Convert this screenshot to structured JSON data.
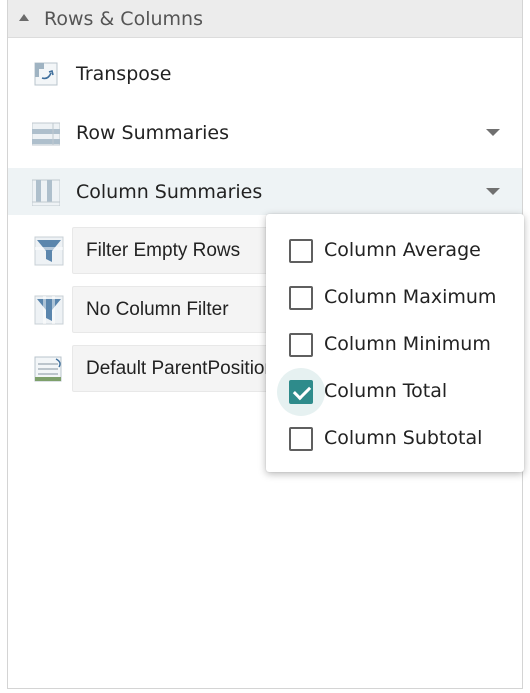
{
  "panel": {
    "title": "Rows & Columns",
    "items": [
      {
        "label": "Transpose",
        "icon": "transpose-icon"
      },
      {
        "label": "Row Summaries",
        "icon": "row-summaries-icon"
      },
      {
        "label": "Column Summaries",
        "icon": "column-summaries-icon"
      }
    ],
    "buttons": [
      {
        "label": "Filter Empty Rows",
        "icon": "filter-icon"
      },
      {
        "label": "No Column Filter",
        "icon": "filter-icon"
      },
      {
        "label": "Default ParentPosition",
        "icon": "parent-position-icon"
      }
    ]
  },
  "column_summaries_menu": {
    "options": [
      {
        "label": "Column Average",
        "checked": false
      },
      {
        "label": "Column Maximum",
        "checked": false
      },
      {
        "label": "Column Minimum",
        "checked": false
      },
      {
        "label": "Column Total",
        "checked": true
      },
      {
        "label": "Column Subtotal",
        "checked": false
      }
    ]
  },
  "colors": {
    "accent": "#2e8b8b",
    "header_bg": "#ececec",
    "hover_bg": "#eef3f5"
  }
}
